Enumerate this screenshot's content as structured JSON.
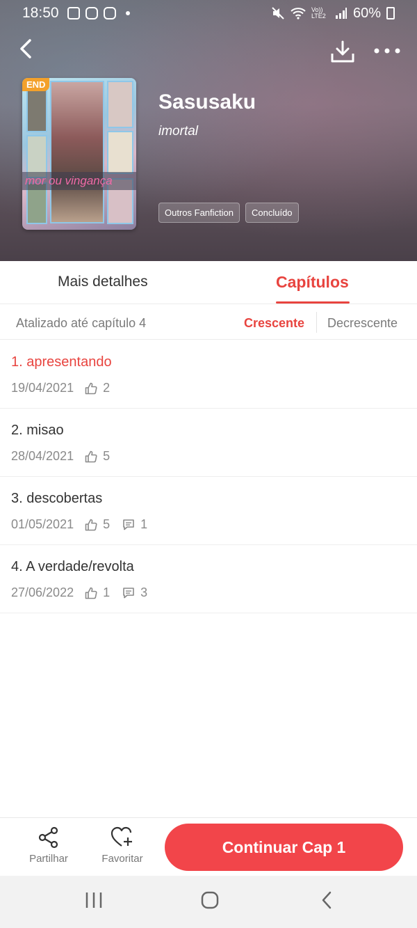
{
  "status_bar": {
    "time": "18:50",
    "battery": "60%",
    "network": "Vo)) LTE2"
  },
  "book": {
    "title": "Sasusaku",
    "author": "imortal",
    "cover_badge": "END",
    "cover_text": "mor ou vingança",
    "tags": [
      "Outros Fanfiction",
      "Concluído"
    ]
  },
  "tabs": [
    {
      "label": "Mais detalhes"
    },
    {
      "label": "Capítulos"
    }
  ],
  "sort": {
    "updated": "Atalizado até capítulo 4",
    "ascending": "Crescente",
    "descending": "Decrescente"
  },
  "chapters": [
    {
      "title": "1. apresentando",
      "date": "19/04/2021",
      "likes": "2"
    },
    {
      "title": "2. misao",
      "date": "28/04/2021",
      "likes": "5"
    },
    {
      "title": "3. descobertas",
      "date": "01/05/2021",
      "likes": "5",
      "comments": "1"
    },
    {
      "title": "4. A verdade/revolta",
      "date": "27/06/2022",
      "likes": "1",
      "comments": "3"
    }
  ],
  "actions": {
    "share": "Partilhar",
    "favorite": "Favoritar",
    "continue": "Continuar Cap 1"
  },
  "colors": {
    "accent": "#e8443f",
    "button": "#f2454a"
  }
}
